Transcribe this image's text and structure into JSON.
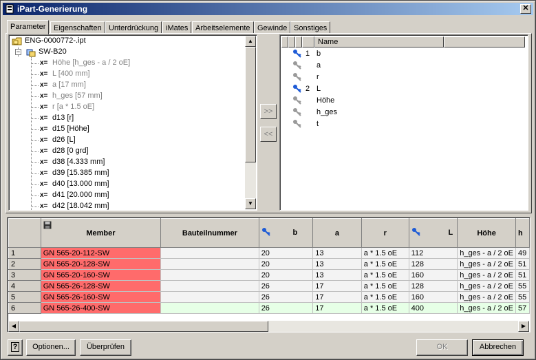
{
  "window": {
    "title": "iPart-Generierung",
    "close_glyph": "✕"
  },
  "tabs": [
    {
      "label": "Parameter"
    },
    {
      "label": "Eigenschaften"
    },
    {
      "label": "Unterdrückung"
    },
    {
      "label": "iMates"
    },
    {
      "label": "Arbeitselemente"
    },
    {
      "label": "Gewinde"
    },
    {
      "label": "Sonstiges"
    }
  ],
  "tree": {
    "root": "ENG-0000772-.ipt",
    "feature": "SW-B20",
    "expander": "−",
    "items": [
      {
        "prefix": "x=",
        "label": "Höhe [h_ges - a / 2 oE]",
        "grey": true
      },
      {
        "prefix": "x=",
        "label": "L [400 mm]",
        "grey": true
      },
      {
        "prefix": "x=",
        "label": "a [17 mm]",
        "grey": true
      },
      {
        "prefix": "x=",
        "label": "h_ges [57 mm]",
        "grey": true
      },
      {
        "prefix": "x=",
        "label": "r [a * 1.5 oE]",
        "grey": true
      },
      {
        "prefix": "x=",
        "label": "d13 [r]",
        "grey": false
      },
      {
        "prefix": "x=",
        "label": "d15 [Höhe]",
        "grey": false
      },
      {
        "prefix": "x=",
        "label": "d26 [L]",
        "grey": false
      },
      {
        "prefix": "x=",
        "label": "d28 [0 grd]",
        "grey": false
      },
      {
        "prefix": "x=",
        "label": "d38 [4.333 mm]",
        "grey": false
      },
      {
        "prefix": "x=",
        "label": "d39 [15.385 mm]",
        "grey": false
      },
      {
        "prefix": "x=",
        "label": "d40 [13.000 mm]",
        "grey": false
      },
      {
        "prefix": "x=",
        "label": "d41 [20.000 mm]",
        "grey": false
      },
      {
        "prefix": "x=",
        "label": "d42 [18.042 mm]",
        "grey": false
      }
    ]
  },
  "mid_buttons": {
    "add": ">>",
    "remove": "<<"
  },
  "param_list": {
    "header_name": "Name",
    "items": [
      {
        "key": true,
        "index": "1",
        "name": "b"
      },
      {
        "key": false,
        "index": "",
        "name": "a"
      },
      {
        "key": false,
        "index": "",
        "name": "r"
      },
      {
        "key": true,
        "index": "2",
        "name": "L"
      },
      {
        "key": false,
        "index": "",
        "name": "Höhe"
      },
      {
        "key": false,
        "index": "",
        "name": "h_ges"
      },
      {
        "key": false,
        "index": "",
        "name": "t"
      }
    ]
  },
  "grid": {
    "headers": {
      "member": "Member",
      "partnumber": "Bauteilnummer",
      "b": "b",
      "a": "a",
      "r": "r",
      "L": "L",
      "hoehe": "Höhe",
      "next": "h"
    },
    "rows": [
      {
        "n": "1",
        "member": "GN 565-20-112-SW",
        "partnumber": "",
        "b": "20",
        "a": "13",
        "r": "a * 1.5 oE",
        "L": "112",
        "hoehe": "h_ges - a / 2 oE",
        "next": "49"
      },
      {
        "n": "2",
        "member": "GN 565-20-128-SW",
        "partnumber": "",
        "b": "20",
        "a": "13",
        "r": "a * 1.5 oE",
        "L": "128",
        "hoehe": "h_ges - a / 2 oE",
        "next": "51"
      },
      {
        "n": "3",
        "member": "GN 565-20-160-SW",
        "partnumber": "",
        "b": "20",
        "a": "13",
        "r": "a * 1.5 oE",
        "L": "160",
        "hoehe": "h_ges - a / 2 oE",
        "next": "51"
      },
      {
        "n": "4",
        "member": "GN 565-26-128-SW",
        "partnumber": "",
        "b": "26",
        "a": "17",
        "r": "a * 1.5 oE",
        "L": "128",
        "hoehe": "h_ges - a / 2 oE",
        "next": "55"
      },
      {
        "n": "5",
        "member": "GN 565-26-160-SW",
        "partnumber": "",
        "b": "26",
        "a": "17",
        "r": "a * 1.5 oE",
        "L": "160",
        "hoehe": "h_ges - a / 2 oE",
        "next": "55"
      },
      {
        "n": "6",
        "member": "GN 565-26-400-SW",
        "partnumber": "",
        "b": "26",
        "a": "17",
        "r": "a * 1.5 oE",
        "L": "400",
        "hoehe": "h_ges - a / 2 oE",
        "next": "57"
      }
    ]
  },
  "footer": {
    "help_glyph": "?",
    "options_label": "Optionen...",
    "check_label": "Überprüfen",
    "ok_label": "OK",
    "cancel_label": "Abbrechen"
  },
  "colors": {
    "title_start": "#0a246a",
    "title_end": "#a6caf0",
    "member_cell": "#ff6b6b",
    "active_row": "#e6ffe6",
    "key_icon": "#1e5bd6"
  }
}
